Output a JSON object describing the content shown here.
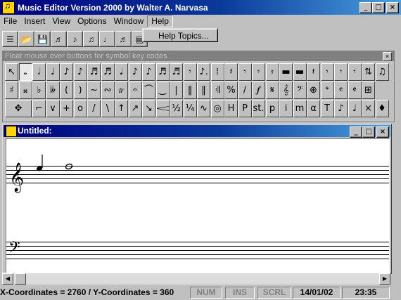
{
  "app": {
    "title": "Music Editor Version 2000 by Walter A. Narvasa"
  },
  "window_buttons": {
    "minimize": "_",
    "maximize": "□",
    "close": "×"
  },
  "menu": [
    {
      "label": "File"
    },
    {
      "label": "Insert"
    },
    {
      "label": "View"
    },
    {
      "label": "Options"
    },
    {
      "label": "Window"
    },
    {
      "label": "Help"
    }
  ],
  "help_menu": {
    "items": [
      {
        "label": "Help Topics..."
      }
    ]
  },
  "toolbar": {
    "buttons": [
      {
        "icon": "list-icon",
        "glyph": "☰"
      },
      {
        "icon": "open-icon",
        "glyph": "📂"
      },
      {
        "icon": "save-icon",
        "glyph": "💾"
      },
      {
        "icon": "tool-icon-1",
        "glyph": "♬"
      },
      {
        "icon": "tool-icon-2",
        "glyph": "♪"
      },
      {
        "icon": "tool-icon-3",
        "glyph": "♫"
      },
      {
        "icon": "tool-icon-4",
        "glyph": "♩"
      },
      {
        "icon": "tool-icon-5",
        "glyph": "♬"
      },
      {
        "icon": "tool-icon-6",
        "glyph": "▤"
      }
    ]
  },
  "palette": {
    "hint": "Float mouse over buttons for symbol key codes",
    "close": "×",
    "rows": [
      [
        "↖",
        "𝅝",
        "𝅗𝅥",
        "♩",
        "♪",
        "♪",
        "♬",
        "♬",
        "𝅘𝅥",
        "♪",
        "♪",
        "♬",
        "♬",
        "𝄾",
        "♪.",
        "⁞",
        "𝄽",
        "𝄾",
        "𝄾",
        "𝄿",
        "▬",
        "▬",
        "𝄽",
        "𝄾",
        "𝄾",
        "𝄾",
        "⇅"
      ],
      [
        "♫",
        "♯",
        "𝄪",
        "♭",
        "𝄫",
        "(",
        ")",
        "~",
        "∾",
        "𝆖",
        "𝄐",
        "⌒",
        "‿",
        "|",
        "‖",
        "‖",
        "𝄇",
        "%",
        "/",
        "𝆑",
        "𝄋",
        "𝄞",
        "𝄢",
        "⊕",
        "𝄌",
        "𝄴",
        "𝄵"
      ],
      [
        "⊞",
        "✥",
        "⌐",
        "∨",
        "+",
        "o",
        "/",
        "\\",
        "↑",
        "↗",
        "↘",
        "𝆒",
        "½",
        "¼",
        "∿",
        "◎",
        "H",
        "P",
        "st.",
        "p",
        "i",
        "m",
        "α",
        "T",
        "♪",
        "♩",
        "×",
        "♦"
      ]
    ]
  },
  "document": {
    "title": "Untitled:"
  },
  "status": {
    "coords": "X-Coordinates = 2760   /   Y-Coordinates = 360",
    "num": "NUM",
    "ins": "INS",
    "scrl": "SCRL",
    "date": "14/01/02",
    "time": "23:35"
  },
  "colors": {
    "titlebar_start": "#000080",
    "titlebar_end": "#4aa0e0",
    "face": "#c0c0c0"
  }
}
